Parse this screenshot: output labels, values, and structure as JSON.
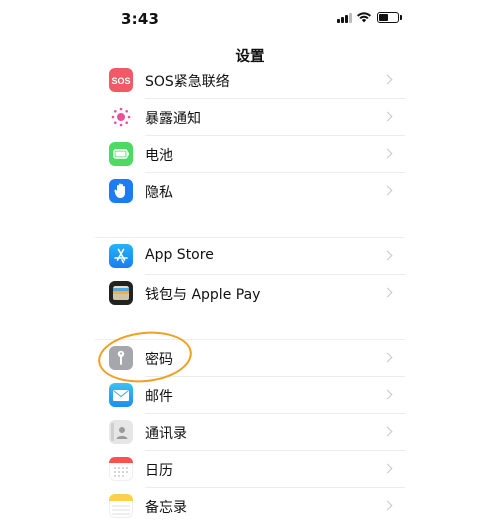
{
  "status_bar": {
    "time": "3:43"
  },
  "nav": {
    "title": "设置"
  },
  "groups": [
    {
      "items": [
        {
          "label": "SOS紧急联络",
          "icon": "sos-icon",
          "color": "#f05a67",
          "icon_text": "SOS"
        },
        {
          "label": "暴露通知",
          "icon": "exposure-notification-icon",
          "color": "#ffffff"
        },
        {
          "label": "电池",
          "icon": "battery-icon",
          "color": "#4cd964"
        },
        {
          "label": "隐私",
          "icon": "privacy-hand-icon",
          "color": "#1e7cf2"
        }
      ]
    },
    {
      "items": [
        {
          "label": "App Store",
          "icon": "app-store-icon",
          "color": "#1a9bf0"
        },
        {
          "label": "钱包与 Apple Pay",
          "icon": "wallet-icon",
          "color": "#222222"
        }
      ]
    },
    {
      "items": [
        {
          "label": "密码",
          "icon": "key-icon",
          "color": "#a6a6ad"
        },
        {
          "label": "邮件",
          "icon": "mail-icon",
          "color": "#2ea7f5"
        },
        {
          "label": "通讯录",
          "icon": "contacts-icon",
          "color": "#d8d8d8"
        },
        {
          "label": "日历",
          "icon": "calendar-icon",
          "color": "#ffffff"
        },
        {
          "label": "备忘录",
          "icon": "notes-icon",
          "color": "#f8d24a"
        }
      ]
    }
  ],
  "annotation": {
    "color": "#f0a020",
    "target": "密码"
  }
}
